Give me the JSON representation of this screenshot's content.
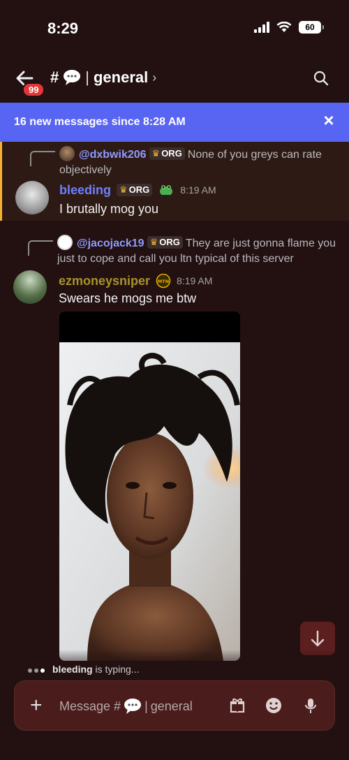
{
  "status_bar": {
    "time": "8:29",
    "battery": "60"
  },
  "header": {
    "badge_count": "99",
    "hash": "#",
    "channel_name": "general",
    "chevron": "›"
  },
  "banner": {
    "text": "16 new messages since 8:28 AM",
    "close": "×"
  },
  "messages": [
    {
      "reply": {
        "mention": "@dxbwik206",
        "tag": "ORG",
        "text": "None of you greys can rate objectively"
      },
      "author": "bleeding",
      "author_color": "#6d80ff",
      "tag": "ORG",
      "time": "8:19 AM",
      "body": "I brutally mog you"
    },
    {
      "reply": {
        "mention": "@jacojack19",
        "tag": "ORG",
        "text": "They are just gonna flame you just to cope and call you ltn typical of this server"
      },
      "author": "ezmoneysniper",
      "author_color": "#a6942a",
      "badge": "MTN",
      "time": "8:19 AM",
      "body": "Swears he mogs me btw"
    }
  ],
  "typing": {
    "user": "bleeding",
    "suffix": "is typing..."
  },
  "composer": {
    "placeholder_prefix": "Message #",
    "placeholder_channel": "general"
  }
}
